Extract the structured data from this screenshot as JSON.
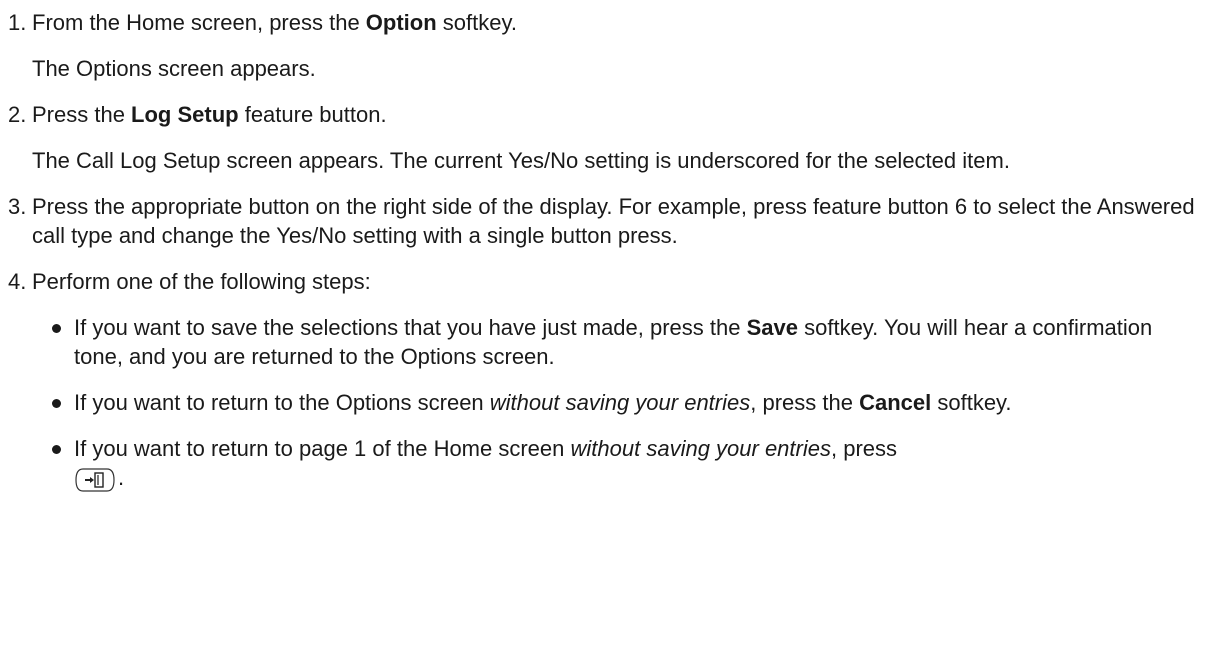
{
  "steps": [
    {
      "num": "1.",
      "pre": "From the Home screen, press the ",
      "bold": "Option",
      "post": " softkey.",
      "result": "The Options screen appears."
    },
    {
      "num": "2.",
      "pre": "Press the ",
      "bold": "Log Setup",
      "post": " feature button.",
      "result": "The Call Log Setup screen appears. The current Yes/No setting is underscored for the selected item."
    },
    {
      "num": "3.",
      "text": "Press the appropriate button on the right side of the display. For example, press feature button 6 to select the Answered call type and change the Yes/No setting with a single button press."
    },
    {
      "num": "4.",
      "text": "Perform one of the following steps:"
    }
  ],
  "bullets": [
    {
      "pre": "If you want to save the selections that you have just made, press the ",
      "bold": "Save",
      "post": " softkey. You will hear a confirmation tone, and you are returned to the Options screen."
    },
    {
      "pre": "If you want to return to the Options screen ",
      "italic": "without saving your entries",
      "mid": ", press the ",
      "bold": "Cancel",
      "post": " softkey."
    },
    {
      "pre": "If you want to return to page 1 of the Home screen ",
      "italic": "without saving your entries",
      "mid": ", press",
      "end": "."
    }
  ],
  "icons": {
    "home_key": "exit-home-key-icon"
  }
}
